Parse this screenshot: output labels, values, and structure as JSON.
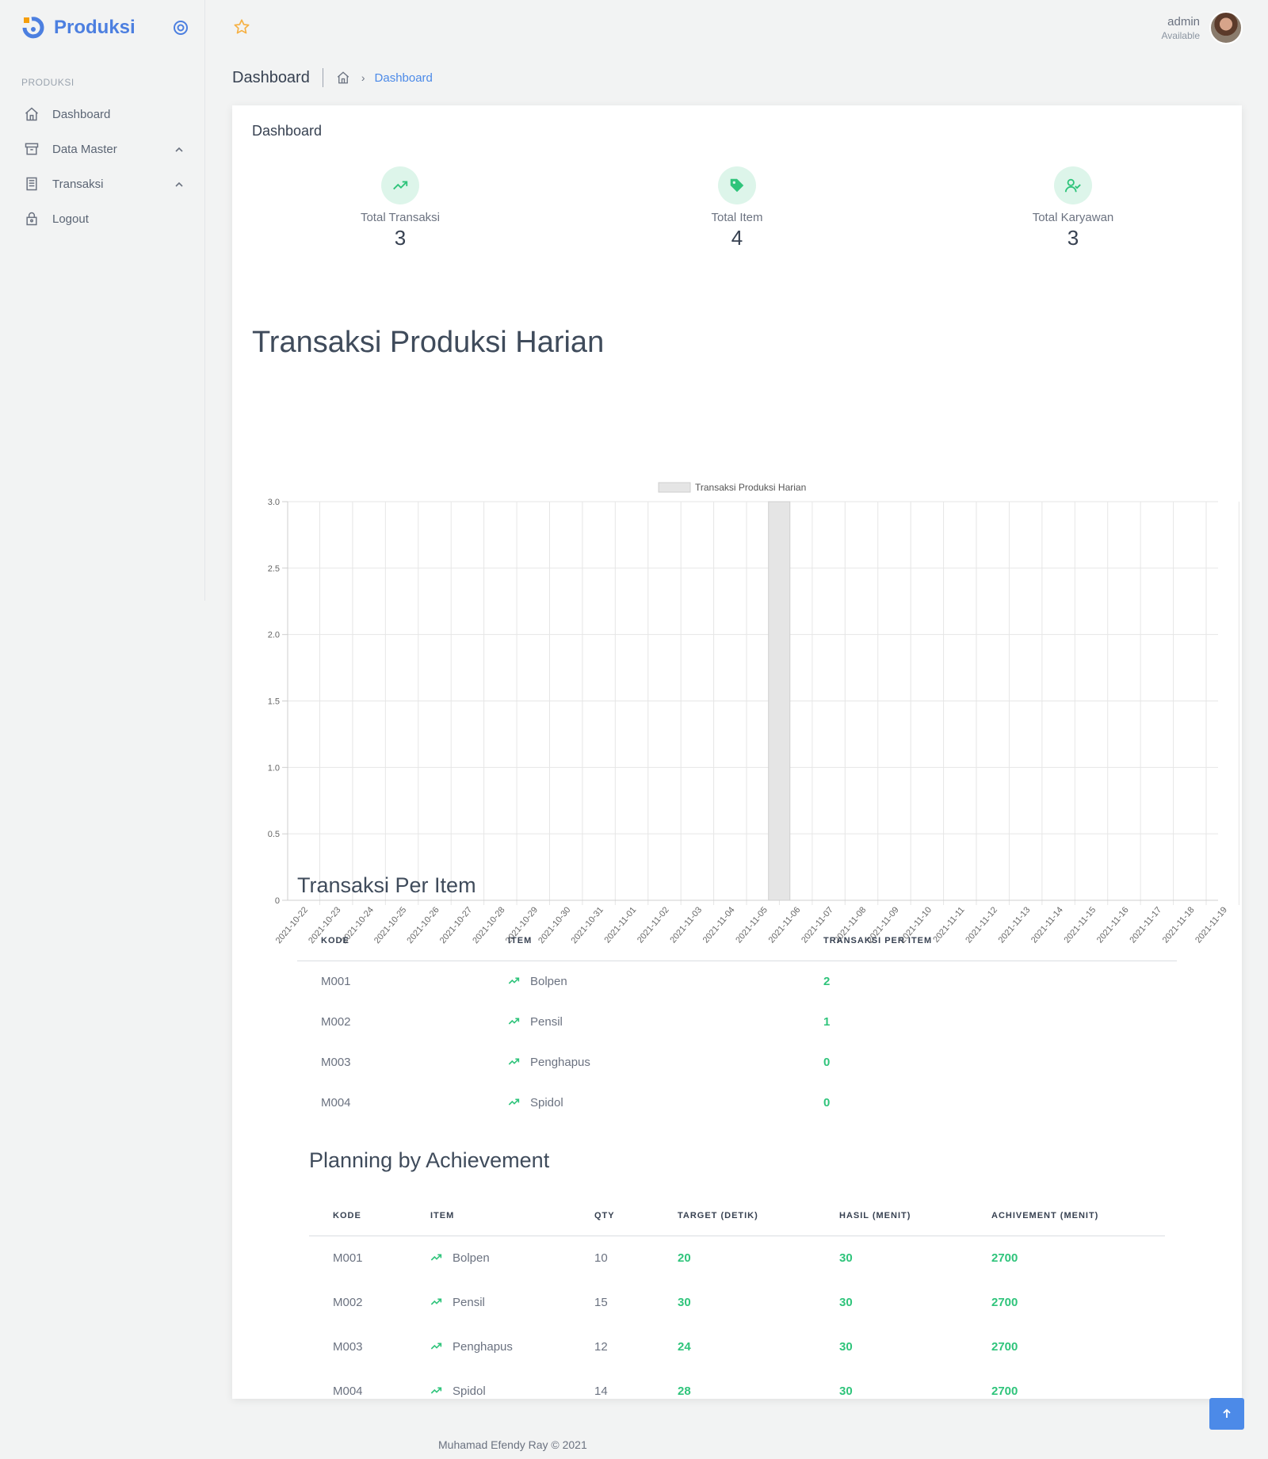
{
  "brand": {
    "name": "Produksi",
    "accent": "#4c7fe0"
  },
  "sidebar": {
    "section": "PRODUKSI",
    "items": [
      {
        "label": "Dashboard",
        "icon": "home-icon",
        "expandable": false
      },
      {
        "label": "Data Master",
        "icon": "archive-icon",
        "expandable": true
      },
      {
        "label": "Transaksi",
        "icon": "document-icon",
        "expandable": true
      },
      {
        "label": "Logout",
        "icon": "lock-icon",
        "expandable": false
      }
    ]
  },
  "topbar": {
    "user_name": "admin",
    "user_status": "Available"
  },
  "breadcrumb": {
    "title": "Dashboard",
    "current": "Dashboard"
  },
  "card": {
    "title": "Dashboard"
  },
  "stats": [
    {
      "label": "Total Transaksi",
      "value": "3",
      "icon": "trending-up-icon"
    },
    {
      "label": "Total Item",
      "value": "4",
      "icon": "tag-icon"
    },
    {
      "label": "Total Karyawan",
      "value": "3",
      "icon": "user-check-icon"
    }
  ],
  "chart_title": "Transaksi Produksi Harian",
  "chart_data": {
    "type": "bar",
    "categories": [
      "2021-10-22",
      "2021-10-23",
      "2021-10-24",
      "2021-10-25",
      "2021-10-26",
      "2021-10-27",
      "2021-10-28",
      "2021-10-29",
      "2021-10-30",
      "2021-10-31",
      "2021-11-01",
      "2021-11-02",
      "2021-11-03",
      "2021-11-04",
      "2021-11-05",
      "2021-11-06",
      "2021-11-07",
      "2021-11-08",
      "2021-11-09",
      "2021-11-10",
      "2021-11-11",
      "2021-11-12",
      "2021-11-13",
      "2021-11-14",
      "2021-11-15",
      "2021-11-16",
      "2021-11-17",
      "2021-11-18",
      "2021-11-19"
    ],
    "series": [
      {
        "name": "Transaksi Produksi Harian",
        "values": [
          0,
          0,
          0,
          0,
          0,
          0,
          0,
          0,
          0,
          0,
          0,
          0,
          0,
          0,
          3,
          0,
          0,
          0,
          0,
          0,
          0,
          0,
          0,
          0,
          0,
          0,
          0,
          0,
          0
        ]
      }
    ],
    "yticks": [
      "0",
      "0.5",
      "1.0",
      "1.5",
      "2.0",
      "2.5",
      "3.0"
    ],
    "ylim": [
      0,
      3
    ],
    "grid": true,
    "legend": "top",
    "bar_color": "#e5e5e5"
  },
  "per_item": {
    "title": "Transaksi Per Item",
    "headers": [
      "KODE",
      "ITEM",
      "TRANSAKSI PER ITEM"
    ],
    "rows": [
      {
        "kode": "M001",
        "item": "Bolpen",
        "count": "2"
      },
      {
        "kode": "M002",
        "item": "Pensil",
        "count": "1"
      },
      {
        "kode": "M003",
        "item": "Penghapus",
        "count": "0"
      },
      {
        "kode": "M004",
        "item": "Spidol",
        "count": "0"
      }
    ]
  },
  "planning": {
    "title": "Planning by Achievement",
    "headers": [
      "KODE",
      "ITEM",
      "QTY",
      "TARGET (DETIK)",
      "HASIL (MENIT)",
      "ACHIVEMENT (MENIT)"
    ],
    "rows": [
      {
        "kode": "M001",
        "item": "Bolpen",
        "qty": "10",
        "target": "20",
        "hasil": "30",
        "achievement": "2700"
      },
      {
        "kode": "M002",
        "item": "Pensil",
        "qty": "15",
        "target": "30",
        "hasil": "30",
        "achievement": "2700"
      },
      {
        "kode": "M003",
        "item": "Penghapus",
        "qty": "12",
        "target": "24",
        "hasil": "30",
        "achievement": "2700"
      },
      {
        "kode": "M004",
        "item": "Spidol",
        "qty": "14",
        "target": "28",
        "hasil": "30",
        "achievement": "2700"
      }
    ]
  },
  "footer": "Muhamad Efendy Ray © 2021",
  "colors": {
    "green": "#2fc47b",
    "blue": "#4c8ae8",
    "star": "#f6b042"
  }
}
